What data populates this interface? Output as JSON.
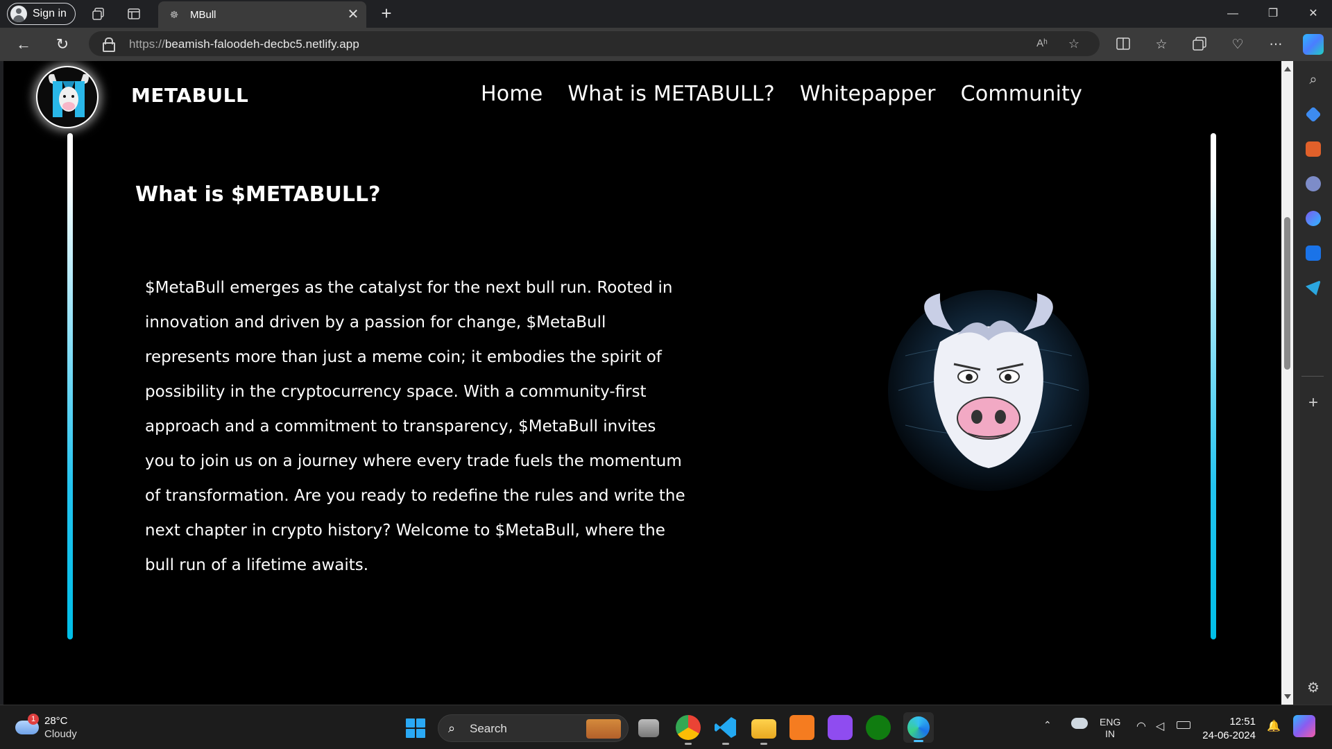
{
  "browser": {
    "sign_in_label": "Sign in",
    "tab_title": "MBull",
    "url_protocol": "https://",
    "url_host": "beamish-faloodeh-decbc5.netlify.app"
  },
  "page": {
    "brand": "METABULL",
    "nav": [
      {
        "label": "Home"
      },
      {
        "label": "What is METABULL?"
      },
      {
        "label": "Whitepapper"
      },
      {
        "label": "Community"
      }
    ],
    "heading": "What is $METABULL?",
    "paragraph": "$MetaBull emerges as the catalyst for the next bull run. Rooted in innovation and driven by a passion for change, $MetaBull represents more than just a meme coin; it embodies the spirit of possibility in the cryptocurrency space. With a community-first approach and a commitment to transparency, $MetaBull invites you to join us on a journey where every trade fuels the momentum of transformation. Are you ready to redefine the rules and write the next chapter in crypto history? Welcome to $MetaBull, where the bull run of a lifetime awaits.",
    "accent_color": "#00bfe8"
  },
  "taskbar": {
    "weather_badge": "1",
    "temperature": "28°C",
    "condition": "Cloudy",
    "search_label": "Search",
    "lang_line1": "ENG",
    "lang_line2": "IN",
    "time": "12:51",
    "date": "24-06-2024"
  }
}
